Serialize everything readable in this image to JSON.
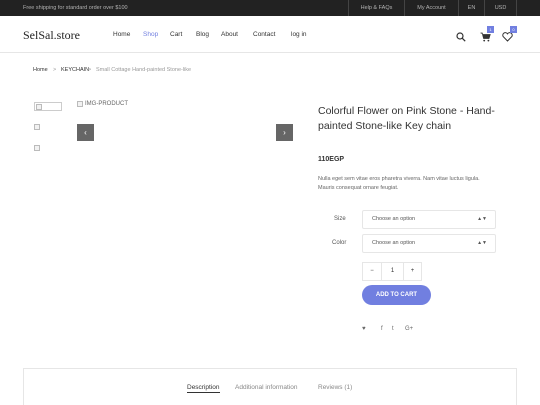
{
  "topbar": {
    "shipping": "Free shipping for standard order over $100",
    "links": [
      "Help & FAQs",
      "My Account",
      "EN",
      "USD"
    ]
  },
  "header": {
    "logo": "SelSal.store",
    "nav": [
      "Home",
      "Shop",
      "Cart",
      "Blog",
      "About",
      "Contact",
      "log in"
    ],
    "active_nav": "Shop",
    "cart_count": "1",
    "wishlist_count": "0"
  },
  "breadcrumb": {
    "home": "Home",
    "category": "KEYCHAIN",
    "current": "Small Cottage Hand-painted Stone-like",
    "separator": ">"
  },
  "gallery": {
    "main_image_alt": "IMG-PRODUCT",
    "prev": "‹",
    "next": "›"
  },
  "product": {
    "title": "Colorful Flower on Pink Stone - Hand-painted Stone-like Key chain",
    "price": "110EGP",
    "description": "Nulla eget sem vitae eros pharetra viverra. Nam vitae luctus ligula. Mauris consequat ornare feugiat.",
    "size_label": "Size",
    "size_placeholder": "Choose an option",
    "color_label": "Color",
    "color_placeholder": "Choose an option",
    "quantity": "1",
    "minus": "−",
    "plus": "+",
    "add_to_cart": "ADD TO CART",
    "share": [
      "♥",
      "f",
      "t",
      "G+"
    ]
  },
  "tabs": [
    "Description",
    "Additional information",
    "Reviews (1)"
  ],
  "colors": {
    "accent": "#717fe0",
    "topbar_bg": "#222222",
    "arrow_bg": "#666666"
  }
}
